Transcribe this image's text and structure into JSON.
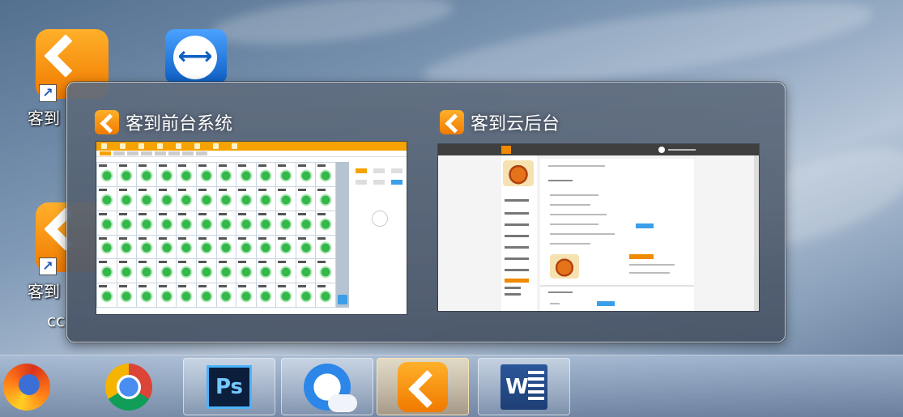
{
  "desktop": {
    "icons": [
      {
        "label": "客到",
        "icon": "kedao-shortcut-icon"
      },
      {
        "label": "客到",
        "icon": "kedao-shortcut-icon"
      }
    ],
    "partial_label": "cc",
    "teamviewer_icon": "teamviewer-icon"
  },
  "preview": {
    "windows": [
      {
        "title": "客到前台系统",
        "icon": "kedao-app-icon"
      },
      {
        "title": "客到云后台",
        "icon": "kedao-app-icon"
      }
    ]
  },
  "taskbar": {
    "buttons": [
      {
        "name": "firefox",
        "icon": "firefox-icon"
      },
      {
        "name": "chrome",
        "icon": "chrome-icon"
      },
      {
        "name": "photoshop",
        "icon": "photoshop-icon",
        "text": "Ps"
      },
      {
        "name": "qq-browser",
        "icon": "qq-browser-icon"
      },
      {
        "name": "kedao",
        "icon": "kedao-icon",
        "active": true
      },
      {
        "name": "word",
        "icon": "word-icon",
        "text": "W"
      }
    ]
  },
  "colors": {
    "brand_orange": "#f08a00",
    "pos_bar": "#f6a200",
    "table_green": "#34b84a",
    "accent_blue": "#3a9ee8"
  }
}
